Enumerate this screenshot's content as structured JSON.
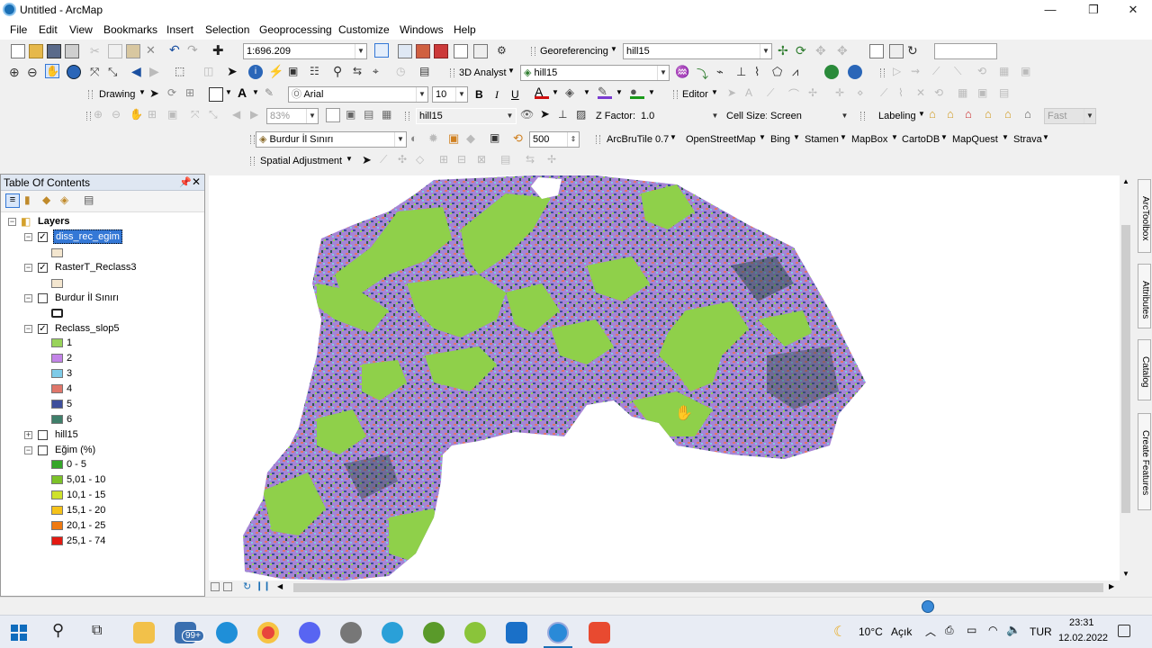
{
  "window": {
    "title": "Untitled - ArcMap",
    "min": "—",
    "max": "❐",
    "close": "✕"
  },
  "menu": [
    "File",
    "Edit",
    "View",
    "Bookmarks",
    "Insert",
    "Selection",
    "Geoprocessing",
    "Customize",
    "Windows",
    "Help"
  ],
  "toolbar": {
    "scale": "1:696.209",
    "georeferencing": "Georeferencing",
    "georef_layer": "hill15",
    "analyst": "3D Analyst",
    "analyst_layer": "hill15",
    "drawing": "Drawing",
    "font": "Arial",
    "font_size": "10",
    "bold": "B",
    "italic": "I",
    "underline": "U",
    "editor": "Editor",
    "zoom_pct": "83%",
    "layer3d": "hill15",
    "zfactor_label": "Z Factor:",
    "zfactor": "1.0",
    "cellsize_label": "Cell Size:",
    "cellsize": "Screen",
    "labeling": "Labeling",
    "fast": "Fast",
    "burdur_layer": "Burdur İl Sınırı",
    "level": "500",
    "arcbrutile": "ArcBruTile 0.7",
    "tiles": [
      "OpenStreetMap",
      "Bing",
      "Stamen",
      "MapBox",
      "CartoDB",
      "MapQuest",
      "Strava"
    ],
    "spatial_adjustment": "Spatial Adjustment"
  },
  "toc": {
    "title": "Table Of Contents",
    "root": "Layers",
    "layers": [
      {
        "name": "diss_rec_egim",
        "checked": true,
        "selected": true
      },
      {
        "name": "RasterT_Reclass3",
        "checked": true
      },
      {
        "name": "Burdur İl Sınırı",
        "checked": false
      },
      {
        "name": "Reclass_slop5",
        "checked": true
      },
      {
        "name": "hill15",
        "checked": false
      },
      {
        "name": "Eğim (%)",
        "checked": false
      }
    ],
    "reclass_classes": [
      {
        "label": "1",
        "color": "#98d35a"
      },
      {
        "label": "2",
        "color": "#c384e8"
      },
      {
        "label": "3",
        "color": "#7ecbe8"
      },
      {
        "label": "4",
        "color": "#e0766a"
      },
      {
        "label": "5",
        "color": "#3e4f9c"
      },
      {
        "label": "6",
        "color": "#3f7f6a"
      }
    ],
    "egim_classes": [
      {
        "label": "0 - 5",
        "color": "#35a62a"
      },
      {
        "label": "5,01 - 10",
        "color": "#7cc228"
      },
      {
        "label": "10,1 - 15",
        "color": "#cfe22c"
      },
      {
        "label": "15,1 - 20",
        "color": "#f5c219"
      },
      {
        "label": "20,1 - 25",
        "color": "#ef7a12"
      },
      {
        "label": "25,1 - 74",
        "color": "#e41a12"
      }
    ]
  },
  "dock_tabs": [
    "ArcToolbox",
    "Attributes",
    "Catalog",
    "Create Features"
  ],
  "taskbar": {
    "badge": "99+",
    "weather": "10°C",
    "weather_desc": "Açık",
    "lang": "TUR",
    "time": "23:31",
    "date": "12.02.2022"
  },
  "colors": {
    "green": "#8fd04a",
    "purple": "#b57ce0",
    "dark": "#2e4a4c",
    "selection": "#3478d6"
  }
}
